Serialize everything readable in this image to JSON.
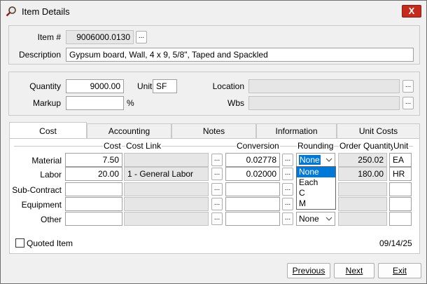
{
  "window": {
    "title": "Item Details",
    "close_label": "X"
  },
  "header": {
    "item_label": "Item #",
    "item_value": "9006000.0130",
    "description_label": "Description",
    "description_value": "Gypsum board, Wall, 4 x 9, 5/8\", Taped and Spackled"
  },
  "qty": {
    "quantity_label": "Quantity",
    "quantity_value": "9000.00",
    "unit_label": "Unit",
    "unit_value": "SF",
    "location_label": "Location",
    "location_value": "",
    "markup_label": "Markup",
    "markup_value": "",
    "percent": "%",
    "wbs_label": "Wbs",
    "wbs_value": ""
  },
  "tabs": [
    "Cost",
    "Accounting",
    "Notes",
    "Information",
    "Unit Costs"
  ],
  "cost_table": {
    "headers": {
      "cost": "Cost",
      "cost_link": "Cost Link",
      "conversion": "Conversion",
      "rounding": "Rounding",
      "order_quantity": "Order Quantity",
      "unit": "Unit"
    },
    "rows": [
      {
        "label": "Material",
        "cost": "7.50",
        "cost_link": "",
        "conversion": "0.02778",
        "rounding": "None",
        "order_quantity": "250.02",
        "unit": "EA"
      },
      {
        "label": "Labor",
        "cost": "20.00",
        "cost_link": "1 - General Labor",
        "conversion": "0.02000",
        "rounding": "",
        "order_quantity": "180.00",
        "unit": "HR"
      },
      {
        "label": "Sub-Contract",
        "cost": "",
        "cost_link": "",
        "conversion": "",
        "rounding": "",
        "order_quantity": "",
        "unit": ""
      },
      {
        "label": "Equipment",
        "cost": "",
        "cost_link": "",
        "conversion": "",
        "rounding": "",
        "order_quantity": "",
        "unit": ""
      },
      {
        "label": "Other",
        "cost": "",
        "cost_link": "",
        "conversion": "",
        "rounding": "None",
        "order_quantity": "",
        "unit": ""
      }
    ],
    "rounding_options": [
      "None",
      "Each",
      "C",
      "M"
    ]
  },
  "footer": {
    "quoted_label": "Quoted Item",
    "date": "09/14/25",
    "previous_label": "Previous",
    "next_label": "Next",
    "exit_label": "Exit"
  },
  "colors": {
    "accent": "#0078d7",
    "close": "#c42b1c",
    "readonly": "#e6e6e6"
  }
}
